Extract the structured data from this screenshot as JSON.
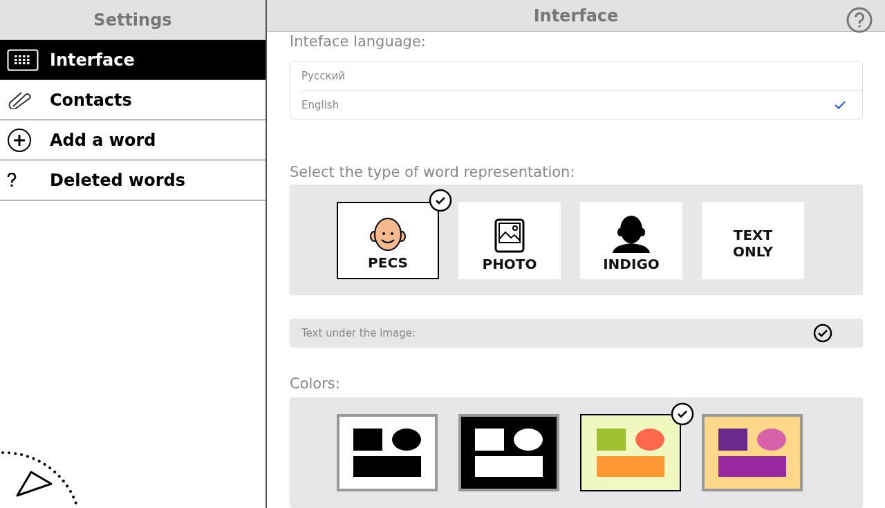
{
  "sidebar": {
    "title": "Settings",
    "items": [
      {
        "label": "Interface",
        "selected": true
      },
      {
        "label": "Contacts",
        "selected": false
      },
      {
        "label": "Add a word",
        "selected": false
      },
      {
        "label": "Deleted words",
        "selected": false
      }
    ]
  },
  "header": {
    "title": "Interface"
  },
  "language": {
    "label": "Inteface language:",
    "options": [
      {
        "label": "Русский",
        "selected": false
      },
      {
        "label": "English",
        "selected": true
      }
    ]
  },
  "representation": {
    "label": "Select the type of word representation:",
    "options": [
      {
        "kind": "pecs",
        "label": "PECS",
        "selected": true
      },
      {
        "kind": "photo",
        "label": "PHOTO",
        "selected": false
      },
      {
        "kind": "indigo",
        "label": "INDIGO",
        "selected": false
      },
      {
        "kind": "text",
        "label": "TEXT ONLY",
        "selected": false
      }
    ]
  },
  "text_under_image": {
    "label": "Text under the image:",
    "checked": true
  },
  "colors": {
    "label": "Colors:",
    "options": [
      {
        "kind": "light",
        "selected": false
      },
      {
        "kind": "dark",
        "selected": false
      },
      {
        "kind": "green",
        "selected": true
      },
      {
        "kind": "orange",
        "selected": false
      }
    ]
  }
}
